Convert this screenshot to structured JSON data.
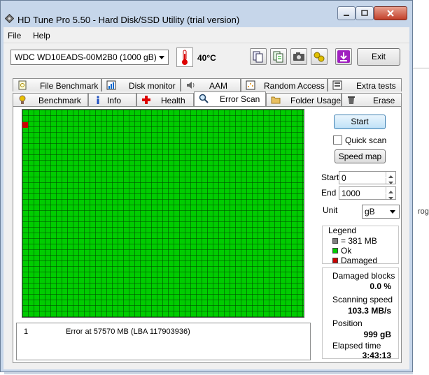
{
  "window": {
    "title": "HD Tune Pro 5.50 - Hard Disk/SSD Utility (trial version)"
  },
  "menu": {
    "file": "File",
    "help": "Help"
  },
  "toolbar": {
    "drive": "WDC WD10EADS-00M2B0 (1000 gB)",
    "temperature": "40°C",
    "exit_label": "Exit",
    "icons": [
      "copy-info-icon",
      "copy-text-icon",
      "screenshot-camera-icon",
      "options-icon",
      "save-download-icon"
    ]
  },
  "tabs": {
    "row1": [
      "File Benchmark",
      "Disk monitor",
      "AAM",
      "Random Access",
      "Extra tests"
    ],
    "row2": [
      "Benchmark",
      "Info",
      "Health",
      "Error Scan",
      "Folder Usage",
      "Erase"
    ],
    "active": "Error Scan"
  },
  "scan": {
    "start_button": "Start",
    "quick_scan_label": "Quick scan",
    "quick_scan_checked": false,
    "speed_map_button": "Speed map",
    "start_label": "Start",
    "start_value": "0",
    "end_label": "End",
    "end_value": "1000",
    "unit_label": "Unit",
    "unit_value": "gB"
  },
  "legend": {
    "title": "Legend",
    "items": [
      {
        "label": "= 381 MB",
        "color": "#808080"
      },
      {
        "label": "Ok",
        "color": "#00cc00"
      },
      {
        "label": "Damaged",
        "color": "#cc0000"
      }
    ]
  },
  "stats": {
    "damaged_blocks_label": "Damaged blocks",
    "damaged_blocks_value": "0.0 %",
    "scanning_speed_label": "Scanning speed",
    "scanning_speed_value": "103.3 MB/s",
    "position_label": "Position",
    "position_value": "999 gB",
    "elapsed_time_label": "Elapsed time",
    "elapsed_time_value": "3:43:13"
  },
  "log": {
    "rows": [
      {
        "index": "1",
        "message": "Error at 57570 MB (LBA 117903936)"
      }
    ]
  },
  "background": {
    "fragment_text": "rogra"
  },
  "colors": {
    "ok_block": "#00cc00",
    "damaged_block": "#cc0000",
    "title_bar": "#c6d6ea",
    "close_button": "#c2402a"
  }
}
